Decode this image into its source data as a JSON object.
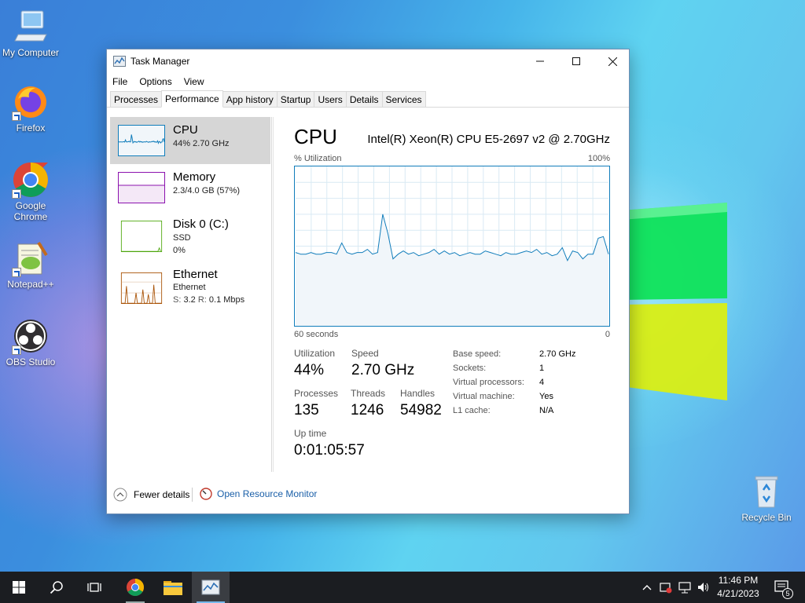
{
  "desktop": {
    "icons": [
      {
        "label": "My Computer"
      },
      {
        "label": "Firefox"
      },
      {
        "label": "Google Chrome"
      },
      {
        "label": "Notepad++"
      },
      {
        "label": "OBS Studio"
      },
      {
        "label": "Recycle Bin"
      }
    ]
  },
  "window": {
    "title": "Task Manager",
    "menu": [
      "File",
      "Options",
      "View"
    ],
    "tabs": [
      "Processes",
      "Performance",
      "App history",
      "Startup",
      "Users",
      "Details",
      "Services"
    ],
    "active_tab": "Performance",
    "sidebar": [
      {
        "name": "CPU",
        "line1": "44%  2.70 GHz",
        "line2": ""
      },
      {
        "name": "Memory",
        "line1": "2.3/4.0 GB (57%)",
        "line2": ""
      },
      {
        "name": "Disk 0 (C:)",
        "line1": "SSD",
        "line2": "0%"
      },
      {
        "name": "Ethernet",
        "line1": "Ethernet",
        "line2_s": "S:",
        "line2_sv": "3.2",
        "line2_r": "R:",
        "line2_rv": "0.1 Mbps"
      }
    ],
    "cpu": {
      "title": "CPU",
      "model": "Intel(R) Xeon(R) CPU E5-2697 v2 @ 2.70GHz",
      "util_label": "% Utilization",
      "max_label": "100%",
      "time_label": "60 seconds",
      "min_label": "0",
      "stats": {
        "utilization_label": "Utilization",
        "utilization": "44%",
        "speed_label": "Speed",
        "speed": "2.70 GHz",
        "processes_label": "Processes",
        "processes": "135",
        "threads_label": "Threads",
        "threads": "1246",
        "handles_label": "Handles",
        "handles": "54982",
        "uptime_label": "Up time",
        "uptime": "0:01:05:57"
      },
      "details": [
        {
          "k": "Base speed:",
          "v": "2.70 GHz"
        },
        {
          "k": "Sockets:",
          "v": "1"
        },
        {
          "k": "Virtual processors:",
          "v": "4"
        },
        {
          "k": "Virtual machine:",
          "v": "Yes"
        },
        {
          "k": "L1 cache:",
          "v": "N/A"
        }
      ],
      "history": [
        46,
        45,
        45,
        46,
        45,
        45,
        46,
        46,
        45,
        52,
        46,
        45,
        46,
        46,
        48,
        45,
        46,
        70,
        58,
        42,
        45,
        47,
        45,
        46,
        44,
        45,
        46,
        48,
        45,
        47,
        45,
        46,
        44,
        45,
        46,
        45,
        45,
        47,
        46,
        45,
        44,
        46,
        45,
        45,
        46,
        47,
        46,
        48,
        45,
        46,
        44,
        45,
        49,
        41,
        47,
        46,
        42,
        45,
        45,
        55,
        56,
        45
      ]
    },
    "footer": {
      "fewer": "Fewer details",
      "monitor": "Open Resource Monitor"
    }
  },
  "taskbar": {
    "time": "11:46 PM",
    "date": "4/21/2023",
    "notifications": "5"
  },
  "colors": {
    "accent": "#117dbb",
    "memory": "#8b12ae",
    "disk": "#4da60c",
    "ethernet": "#a74f01"
  }
}
